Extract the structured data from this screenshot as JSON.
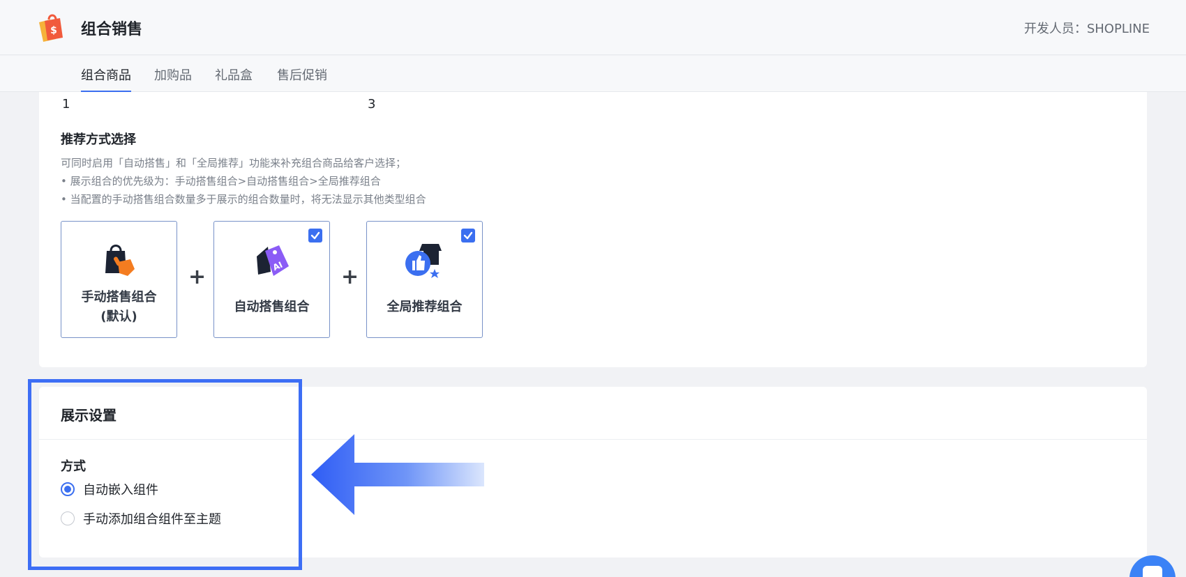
{
  "header": {
    "title": "组合销售",
    "developer": "开发人员：SHOPLINE"
  },
  "tabs": [
    {
      "label": "组合商品",
      "active": true
    },
    {
      "label": "加购品",
      "active": false
    },
    {
      "label": "礼品盒",
      "active": false
    },
    {
      "label": "售后促销",
      "active": false
    }
  ],
  "recommend": {
    "numbers": [
      "1",
      "3"
    ],
    "title": "推荐方式选择",
    "desc_lines": [
      "可同时启用「自动搭售」和「全局推荐」功能来补充组合商品给客户选择；",
      "• 展示组合的优先级为：手动搭售组合>自动搭售组合>全局推荐组合",
      "• 当配置的手动搭售组合数量多于展示的组合数量时，将无法显示其他类型组合"
    ],
    "plus": "+",
    "options": [
      {
        "label_line1": "手动搭售组合",
        "label_line2": "(默认)",
        "checked": false,
        "icon": "shopping-bag-hand-icon"
      },
      {
        "label_line1": "自动搭售组合",
        "checked": true,
        "icon": "ai-tag-icon"
      },
      {
        "label_line1": "全局推荐组合",
        "checked": true,
        "icon": "thumbs-up-store-icon"
      }
    ]
  },
  "display": {
    "title": "展示设置",
    "field_label": "方式",
    "radios": [
      {
        "label": "自动嵌入组件",
        "checked": true
      },
      {
        "label": "手动添加组合组件至主题",
        "checked": false
      }
    ]
  },
  "colors": {
    "accent": "#3b6ff0",
    "highlight": "#3d6ef5"
  }
}
